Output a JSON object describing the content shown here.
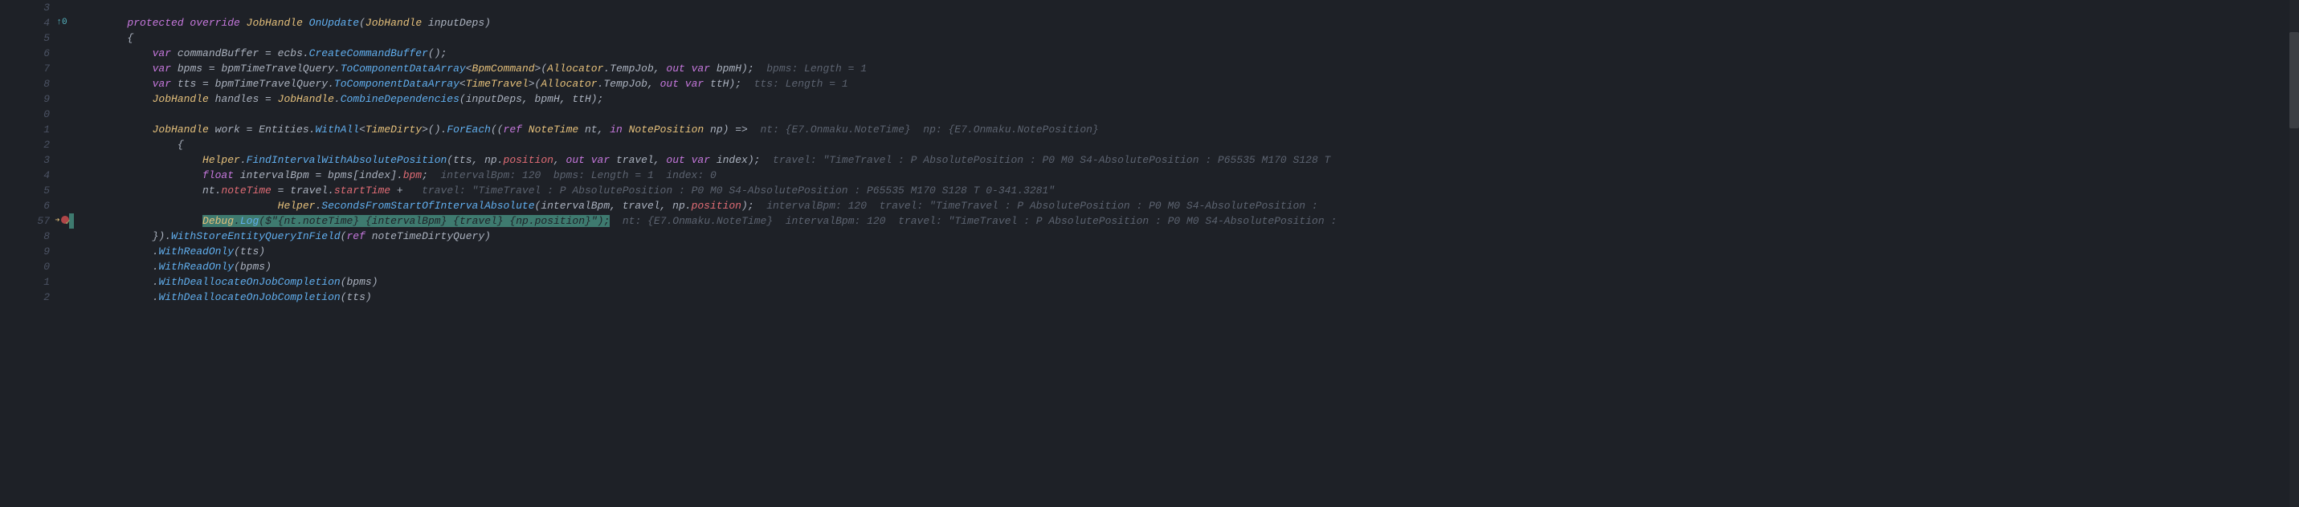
{
  "gutter": {
    "lines": [
      "3",
      "4",
      "5",
      "6",
      "7",
      "8",
      "9",
      "0",
      "1",
      "2",
      "3",
      "4",
      "5",
      "6",
      "57",
      "8",
      "9",
      "0",
      "1",
      "2"
    ],
    "ref_line_index": 1,
    "ref_marker": "↑0",
    "breakpoint_line_index": 14
  },
  "code": [
    {
      "indent": 0,
      "segments": []
    },
    {
      "indent": 2,
      "segments": [
        {
          "t": "protected override ",
          "c": "mod"
        },
        {
          "t": "JobHandle ",
          "c": "type"
        },
        {
          "t": "OnUpdate",
          "c": "fn"
        },
        {
          "t": "(",
          "c": "op"
        },
        {
          "t": "JobHandle ",
          "c": "type"
        },
        {
          "t": "inputDeps",
          "c": "var"
        },
        {
          "t": ")",
          "c": "op"
        }
      ]
    },
    {
      "indent": 2,
      "segments": [
        {
          "t": "{",
          "c": "op"
        }
      ]
    },
    {
      "indent": 3,
      "segments": [
        {
          "t": "var ",
          "c": "kw"
        },
        {
          "t": "commandBuffer = ecbs.",
          "c": "var"
        },
        {
          "t": "CreateCommandBuffer",
          "c": "fn"
        },
        {
          "t": "();",
          "c": "op"
        }
      ]
    },
    {
      "indent": 3,
      "segments": [
        {
          "t": "var ",
          "c": "kw"
        },
        {
          "t": "bpms = bpmTimeTravelQuery.",
          "c": "var"
        },
        {
          "t": "ToComponentDataArray",
          "c": "fn"
        },
        {
          "t": "<",
          "c": "op"
        },
        {
          "t": "BpmCommand",
          "c": "type"
        },
        {
          "t": ">(",
          "c": "op"
        },
        {
          "t": "Allocator",
          "c": "type"
        },
        {
          "t": ".TempJob, ",
          "c": "var"
        },
        {
          "t": "out var ",
          "c": "kw"
        },
        {
          "t": "bpmH);  ",
          "c": "var"
        },
        {
          "t": "bpms: Length = 1",
          "c": "inlay"
        }
      ]
    },
    {
      "indent": 3,
      "segments": [
        {
          "t": "var ",
          "c": "kw"
        },
        {
          "t": "tts = bpmTimeTravelQuery.",
          "c": "var"
        },
        {
          "t": "ToComponentDataArray",
          "c": "fn"
        },
        {
          "t": "<",
          "c": "op"
        },
        {
          "t": "TimeTravel",
          "c": "type"
        },
        {
          "t": ">(",
          "c": "op"
        },
        {
          "t": "Allocator",
          "c": "type"
        },
        {
          "t": ".TempJob, ",
          "c": "var"
        },
        {
          "t": "out var ",
          "c": "kw"
        },
        {
          "t": "ttH);  ",
          "c": "var"
        },
        {
          "t": "tts: Length = 1",
          "c": "inlay"
        }
      ]
    },
    {
      "indent": 3,
      "segments": [
        {
          "t": "JobHandle ",
          "c": "type"
        },
        {
          "t": "handles = ",
          "c": "var"
        },
        {
          "t": "JobHandle",
          "c": "type"
        },
        {
          "t": ".",
          "c": "op"
        },
        {
          "t": "CombineDependencies",
          "c": "fn"
        },
        {
          "t": "(inputDeps, bpmH, ttH);",
          "c": "var"
        }
      ]
    },
    {
      "indent": 0,
      "segments": []
    },
    {
      "indent": 3,
      "segments": [
        {
          "t": "JobHandle ",
          "c": "type"
        },
        {
          "t": "work = Entities.",
          "c": "var"
        },
        {
          "t": "WithAll",
          "c": "fn"
        },
        {
          "t": "<",
          "c": "op"
        },
        {
          "t": "TimeDirty",
          "c": "type"
        },
        {
          "t": ">().",
          "c": "op"
        },
        {
          "t": "ForEach",
          "c": "fn"
        },
        {
          "t": "((",
          "c": "op"
        },
        {
          "t": "ref ",
          "c": "kw"
        },
        {
          "t": "NoteTime ",
          "c": "type"
        },
        {
          "t": "nt, ",
          "c": "var"
        },
        {
          "t": "in ",
          "c": "kw"
        },
        {
          "t": "NotePosition ",
          "c": "type"
        },
        {
          "t": "np) ",
          "c": "var"
        },
        {
          "t": "=>",
          "c": "op"
        },
        {
          "t": "  nt: {E7.Onmaku.NoteTime}  np: {E7.Onmaku.NotePosition}",
          "c": "inlay"
        }
      ]
    },
    {
      "indent": 4,
      "segments": [
        {
          "t": "{",
          "c": "op"
        }
      ]
    },
    {
      "indent": 5,
      "segments": [
        {
          "t": "Helper",
          "c": "type"
        },
        {
          "t": ".",
          "c": "op"
        },
        {
          "t": "FindIntervalWithAbsolutePosition",
          "c": "fn"
        },
        {
          "t": "(tts, np.",
          "c": "var"
        },
        {
          "t": "position",
          "c": "prop"
        },
        {
          "t": ", ",
          "c": "op"
        },
        {
          "t": "out var ",
          "c": "kw"
        },
        {
          "t": "travel, ",
          "c": "var"
        },
        {
          "t": "out var ",
          "c": "kw"
        },
        {
          "t": "index);  ",
          "c": "var"
        },
        {
          "t": "travel: \"TimeTravel : P AbsolutePosition : P0 M0 S4-AbsolutePosition : P65535 M170 S128 T",
          "c": "inlay"
        }
      ]
    },
    {
      "indent": 5,
      "segments": [
        {
          "t": "float ",
          "c": "kw"
        },
        {
          "t": "intervalBpm = bpms[index].",
          "c": "var"
        },
        {
          "t": "bpm",
          "c": "prop"
        },
        {
          "t": ";  ",
          "c": "op"
        },
        {
          "t": "intervalBpm: 120  bpms: Length = 1  index: 0",
          "c": "inlay"
        }
      ]
    },
    {
      "indent": 5,
      "segments": [
        {
          "t": "nt.",
          "c": "var"
        },
        {
          "t": "noteTime",
          "c": "prop"
        },
        {
          "t": " = travel.",
          "c": "var"
        },
        {
          "t": "startTime",
          "c": "prop"
        },
        {
          "t": " +   ",
          "c": "var"
        },
        {
          "t": "travel: \"TimeTravel : P AbsolutePosition : P0 M0 S4-AbsolutePosition : P65535 M170 S128 T 0-341.3281\"",
          "c": "inlay"
        }
      ]
    },
    {
      "indent": 8,
      "segments": [
        {
          "t": "Helper",
          "c": "type"
        },
        {
          "t": ".",
          "c": "op"
        },
        {
          "t": "SecondsFromStartOfIntervalAbsolute",
          "c": "fn"
        },
        {
          "t": "(intervalBpm, travel, np.",
          "c": "var"
        },
        {
          "t": "position",
          "c": "prop"
        },
        {
          "t": ");  ",
          "c": "op"
        },
        {
          "t": "intervalBpm: 120  travel: \"TimeTravel : P AbsolutePosition : P0 M0 S4-AbsolutePosition :",
          "c": "inlay"
        }
      ]
    },
    {
      "indent": 5,
      "hl": true,
      "segments": [
        {
          "t": "Debug",
          "c": "type"
        },
        {
          "t": ".",
          "c": "op"
        },
        {
          "t": "Log",
          "c": "fn"
        },
        {
          "t": "(",
          "c": "op"
        },
        {
          "t": "$\"",
          "c": "str"
        },
        {
          "t": "{",
          "c": "op"
        },
        {
          "t": "nt",
          "c": "var"
        },
        {
          "t": ".",
          "c": "op"
        },
        {
          "t": "noteTime",
          "c": "prop"
        },
        {
          "t": "} {",
          "c": "op"
        },
        {
          "t": "intervalBpm",
          "c": "var"
        },
        {
          "t": "} {",
          "c": "op"
        },
        {
          "t": "travel",
          "c": "var"
        },
        {
          "t": "} {",
          "c": "op"
        },
        {
          "t": "np",
          "c": "var"
        },
        {
          "t": ".",
          "c": "op"
        },
        {
          "t": "position",
          "c": "prop"
        },
        {
          "t": "}",
          "c": "op"
        },
        {
          "t": "\"",
          "c": "str"
        },
        {
          "t": ");",
          "c": "op"
        }
      ],
      "trail": "  nt: {E7.Onmaku.NoteTime}  intervalBpm: 120  travel: \"TimeTravel : P AbsolutePosition : P0 M0 S4-AbsolutePosition :"
    },
    {
      "indent": 3,
      "segments": [
        {
          "t": "}).",
          "c": "op"
        },
        {
          "t": "WithStoreEntityQueryInField",
          "c": "fn"
        },
        {
          "t": "(",
          "c": "op"
        },
        {
          "t": "ref ",
          "c": "kw"
        },
        {
          "t": "noteTimeDirtyQuery)",
          "c": "var"
        }
      ]
    },
    {
      "indent": 3,
      "segments": [
        {
          "t": ".",
          "c": "op"
        },
        {
          "t": "WithReadOnly",
          "c": "fn"
        },
        {
          "t": "(tts)",
          "c": "var"
        }
      ]
    },
    {
      "indent": 3,
      "segments": [
        {
          "t": ".",
          "c": "op"
        },
        {
          "t": "WithReadOnly",
          "c": "fn"
        },
        {
          "t": "(bpms)",
          "c": "var"
        }
      ]
    },
    {
      "indent": 3,
      "segments": [
        {
          "t": ".",
          "c": "op"
        },
        {
          "t": "WithDeallocateOnJobCompletion",
          "c": "fn"
        },
        {
          "t": "(bpms)",
          "c": "var"
        }
      ]
    },
    {
      "indent": 3,
      "segments": [
        {
          "t": ".",
          "c": "op"
        },
        {
          "t": "WithDeallocateOnJobCompletion",
          "c": "fn"
        },
        {
          "t": "(tts)",
          "c": "var"
        }
      ]
    }
  ],
  "colors": {
    "background": "#1e2127",
    "highlight": "#3e7a6f"
  }
}
